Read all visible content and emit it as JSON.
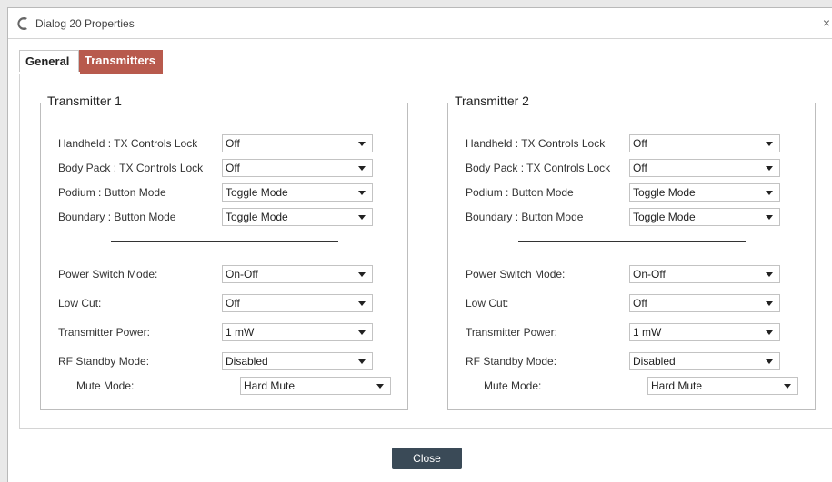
{
  "window": {
    "title": "Dialog 20 Properties",
    "close_glyph": "×",
    "logo_icon": "c-logo-icon"
  },
  "tabs": [
    {
      "label": "General",
      "active": false
    },
    {
      "label": "Transmitters",
      "active": true
    }
  ],
  "accent_color": "#b85a4d",
  "groups": [
    {
      "title": "Transmitter 1",
      "rows": [
        {
          "label": "Handheld : TX Controls Lock",
          "value": "Off"
        },
        {
          "label": "Body Pack : TX Controls Lock",
          "value": "Off"
        },
        {
          "label": "Podium : Button Mode",
          "value": "Toggle Mode"
        },
        {
          "label": "Boundary : Button Mode",
          "value": "Toggle Mode"
        },
        {
          "label": "Power Switch Mode:",
          "value": "On-Off"
        },
        {
          "label": "Low Cut:",
          "value": "Off"
        },
        {
          "label": "Transmitter Power:",
          "value": "1 mW"
        },
        {
          "label": "RF Standby Mode:",
          "value": "Disabled"
        },
        {
          "label": "Mute Mode:",
          "value": "Hard Mute"
        }
      ]
    },
    {
      "title": "Transmitter 2",
      "rows": [
        {
          "label": "Handheld : TX Controls Lock",
          "value": "Off"
        },
        {
          "label": "Body Pack : TX Controls Lock",
          "value": "Off"
        },
        {
          "label": "Podium : Button Mode",
          "value": "Toggle Mode"
        },
        {
          "label": "Boundary : Button Mode",
          "value": "Toggle Mode"
        },
        {
          "label": "Power Switch Mode:",
          "value": "On-Off"
        },
        {
          "label": "Low Cut:",
          "value": "Off"
        },
        {
          "label": "Transmitter Power:",
          "value": "1 mW"
        },
        {
          "label": "RF Standby Mode:",
          "value": "Disabled"
        },
        {
          "label": "Mute Mode:",
          "value": "Hard Mute"
        }
      ]
    }
  ],
  "footer": {
    "close_label": "Close"
  }
}
